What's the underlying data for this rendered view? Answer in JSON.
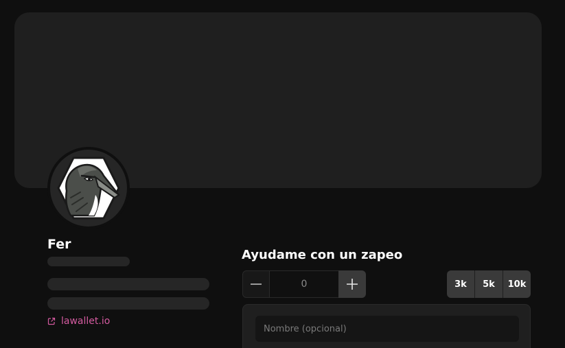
{
  "profile": {
    "name": "Fer",
    "website": "lawallet.io",
    "avatar_icon": "raven-avatar"
  },
  "zap": {
    "title": "Ayudame con un zapeo",
    "amount_value": "0",
    "minus_icon": "minus-icon",
    "plus_icon": "plus-icon",
    "presets": [
      "3k",
      "5k",
      "10k"
    ],
    "name_placeholder": "Nombre (opcional)"
  },
  "colors": {
    "background": "#0f0f0f",
    "banner": "#1f1f1f",
    "skeleton": "#262626",
    "link": "#d45ba0",
    "button": "#3a3a3a"
  }
}
